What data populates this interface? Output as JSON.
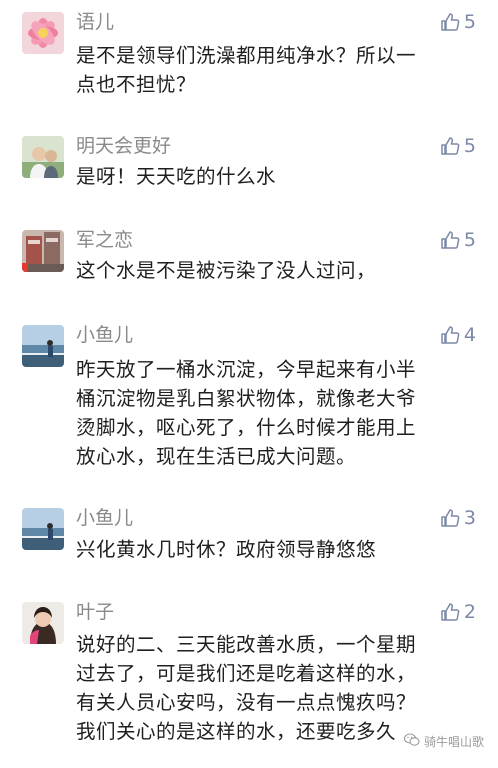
{
  "comments": [
    {
      "author": "语儿",
      "likes": "5",
      "lines": [
        "是不是领导们洗澡都用纯净水？所以一",
        "点也不担忧？"
      ]
    },
    {
      "author": "明天会更好",
      "likes": "5",
      "lines": [
        "是呀！天天吃的什么水"
      ]
    },
    {
      "author": "军之恋",
      "likes": "5",
      "lines": [
        "这个水是不是被污染了没人过问，"
      ]
    },
    {
      "author": "小鱼儿",
      "likes": "4",
      "lines": [
        "昨天放了一桶水沉淀，今早起来有小半",
        "桶沉淀物是乳白絮状物体，就像老大爷",
        "烫脚水，呕心死了，什么时候才能用上",
        "放心水，现在生活已成大问题。"
      ]
    },
    {
      "author": "小鱼儿",
      "likes": "3",
      "lines": [
        "兴化黄水几时休？政府领导静悠悠"
      ]
    },
    {
      "author": "叶子",
      "likes": "2",
      "lines": [
        "说好的二、三天能改善水质，一个星期",
        "过去了，可是我们还是吃着这样的水，",
        "有关人员心安吗，没有一点点愧疚吗？",
        "我们关心的是这样的水，还要吃多久"
      ]
    }
  ],
  "watermark": {
    "text": "骑牛唱山歌",
    "icon": "wechat-icon"
  },
  "colors": {
    "name": "#8a8a8a",
    "like": "#7c89a6",
    "text": "#1f1f1f"
  }
}
